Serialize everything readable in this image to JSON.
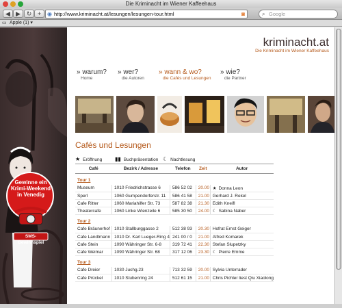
{
  "browser": {
    "window_title": "Die Kriminacht im Wiener Kaffeehaus",
    "url": "http://www.kriminacht.at/lesungen/lesungen-tour.html",
    "search_placeholder": "Google",
    "bookmarks_label": "Apple (1) ▾"
  },
  "site": {
    "logo": "kriminacht.at",
    "tagline": "Die Kriminacht im Wiener Kaffeehaus"
  },
  "nav": [
    {
      "title": "» warum?",
      "sub": "Home",
      "active": false
    },
    {
      "title": "» wer?",
      "sub": "die Autoren",
      "active": false
    },
    {
      "title": "» wann & wo?",
      "sub": "die Cafés und Lesungen",
      "active": true
    },
    {
      "title": "» wie?",
      "sub": "die Partner",
      "active": false
    }
  ],
  "page": {
    "title": "Cafés und Lesungen",
    "legend": [
      {
        "icon": "star-icon",
        "symbol": "★",
        "label": "Eröffnung"
      },
      {
        "icon": "book-icon",
        "symbol": "▮▮",
        "label": "Buchpräsentation"
      },
      {
        "icon": "night-icon",
        "symbol": "☾",
        "label": "Nachtlesung"
      }
    ]
  },
  "sidebar": {
    "promo_line1": "Gewinne ein",
    "promo_line2": "Krimi-Weekend",
    "promo_line3": "in Venedig",
    "sms_label": "SMS-Gewinnspiel"
  },
  "table": {
    "headers": [
      "Café",
      "Bezirk / Adresse",
      "Telefon",
      "Zeit",
      "Autor"
    ],
    "tours": [
      {
        "label": "Tour 1",
        "rows": [
          [
            "Museum",
            "1010 Friedrichstrasse 6",
            "586 52 02",
            "20.00",
            "Donna Leon",
            "★"
          ],
          [
            "Sperl",
            "1060 Gumpendorferstr. 11",
            "586 41 58",
            "21.00",
            "Gerhard J. Rekel",
            ""
          ],
          [
            "Cafe Ritter",
            "1060 Mariahilfer Str. 73",
            "587 82 38",
            "21.30",
            "Edith Kneifl",
            ""
          ],
          [
            "Theatercafe",
            "1060 Linke Wienzeile 6",
            "585 30 50",
            "24.00",
            "Sabina Naber",
            "☾"
          ]
        ]
      },
      {
        "label": "Tour 2",
        "rows": [
          [
            "Cafe Bräunerhof",
            "1010 Stallburggasse 2",
            "512 38 93",
            "20.30",
            "Hofrat Ernst Geiger",
            ""
          ],
          [
            "Cafe Landtmann",
            "1010 Dr. Karl Lueger-Ring 4",
            "241 00 / 0",
            "21.00",
            "Alfred Komarek",
            ""
          ],
          [
            "Cafe Stein",
            "1090 Währinger Str. 6-8",
            "319 72 41",
            "22.30",
            "Stefan Slupetzky",
            ""
          ],
          [
            "Cafe Weimar",
            "1090 Währinger Str. 68",
            "317 12 06",
            "23.30",
            "Pierre Emme",
            "☾"
          ]
        ]
      },
      {
        "label": "Tour 3",
        "rows": [
          [
            "Cafe Dreier",
            "1030 Juchg.23",
            "713 32 59",
            "20.00",
            "Sylvia Unterrader",
            ""
          ],
          [
            "Cafe Prückel",
            "1010 Stubenring 24",
            "512 61 15",
            "21.00",
            "Chris Pichler liest Qiu Xiaolong",
            ""
          ]
        ]
      }
    ]
  }
}
